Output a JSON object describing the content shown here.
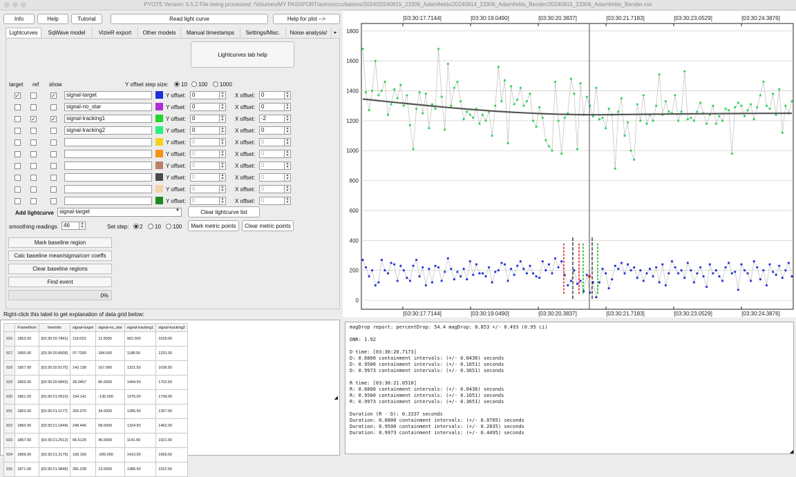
{
  "window": {
    "title": "PYOTE Version: 5.5.2  File being processed: /Volumes/MY PASSPORT/astro/occultations/2024/20240915_23306_Adamfields/20240914_23306_Adamfields_Bender/20240915_23306_Adamfields_Bender.csv"
  },
  "toolbar": {
    "info": "Info",
    "help": "Help",
    "tutorial": "Tutorial",
    "read": "Read light curve",
    "help_plot": "Help for plot -->"
  },
  "tabs": [
    "Lightcurves",
    "SqWave model",
    "VizieR export",
    "Other models",
    "Manual timestamps",
    "Settings/Misc.",
    "Noise analysis/"
  ],
  "tab_scroll": "▸",
  "lc": {
    "help_button": "Lightcurves tab help",
    "col_target": "target",
    "col_ref": "ref",
    "col_show": "show",
    "yoffset_step_label": "Y offset step size:",
    "step_options": [
      "10",
      "100",
      "1000"
    ],
    "yoffset_label": "Y offset:",
    "xoffset_label": "X offset:",
    "rows": [
      {
        "target": "✓",
        "ref": "",
        "show": "✓",
        "name": "signal-target",
        "color": "#1a2fd6",
        "y": "0",
        "x": "0",
        "enabled": true
      },
      {
        "target": "",
        "ref": "",
        "show": "",
        "name": "signal-no_star",
        "color": "#b52bd9",
        "y": "0",
        "x": "0",
        "enabled": true
      },
      {
        "target": "",
        "ref": "✓",
        "show": "✓",
        "name": "signal-tracking1",
        "color": "#22d42b",
        "y": "0",
        "x": "-2",
        "enabled": true
      },
      {
        "target": "",
        "ref": "",
        "show": "",
        "name": "signal-tracking2",
        "color": "#2bf07f",
        "y": "0",
        "x": "0",
        "enabled": true
      },
      {
        "target": "",
        "ref": "",
        "show": "",
        "name": "",
        "color": "#f2d21b",
        "y": "0",
        "x": "0",
        "enabled": false
      },
      {
        "target": "",
        "ref": "",
        "show": "",
        "name": "",
        "color": "#f29312",
        "y": "0",
        "x": "0",
        "enabled": false
      },
      {
        "target": "",
        "ref": "",
        "show": "",
        "name": "",
        "color": "#b98264",
        "y": "0",
        "x": "0",
        "enabled": false
      },
      {
        "target": "",
        "ref": "",
        "show": "",
        "name": "",
        "color": "#4a4a4a",
        "y": "0",
        "x": "0",
        "enabled": false
      },
      {
        "target": "",
        "ref": "",
        "show": "",
        "name": "",
        "color": "#f6d2a8",
        "y": "0",
        "x": "0",
        "enabled": false
      },
      {
        "target": "",
        "ref": "",
        "show": "",
        "name": "",
        "color": "#1e8a1e",
        "y": "0",
        "x": "0",
        "enabled": false
      }
    ],
    "add_label": "Add lightcurve",
    "add_value": "signal-target",
    "clear_list": "Clear lightcurve list",
    "smoothing_label": "smoothing readings",
    "smoothing_value": "46",
    "setstep_label": "Set step:",
    "setstep_options": [
      "2",
      "10",
      "100"
    ],
    "mark_metric": "Mark metric points",
    "clear_metric": "Clear metric points",
    "mark_baseline": "Mark baseline region",
    "calc_baseline": "Calc baseline mean/sigma/corr coeffs",
    "clear_baseline": "Clear baseline regions",
    "find_event": "Find event",
    "progress": "0%"
  },
  "grid_label": "Right-click this label to get explanation of data grid below:",
  "table": {
    "headers": [
      "",
      "FrameNum",
      "timeInfo",
      "signal-target",
      "signal-no_star",
      "signal-tracking1",
      "signal-tracking2"
    ],
    "rows": [
      [
        "926",
        "1853.00",
        "[03:30:20.7841]",
        "119.023",
        "11.0000",
        "962.000",
        "1629.00"
      ],
      [
        "927",
        "1855.00",
        "[03:30:20.8508]",
        "97.7300",
        "184.500",
        "1188.50",
        "1231.00"
      ],
      [
        "928",
        "1857.00",
        "[03:30:20.9175]",
        "142.138",
        "167.000",
        "1321.50",
        "1636.50"
      ],
      [
        "929",
        "1859.00",
        "[03:30:20.9843]",
        "28.0457",
        "80.0000",
        "1494.50",
        "1702.50"
      ],
      [
        "930",
        "1861.00",
        "[03:30:21.0510]",
        "154.141",
        "-136.000",
        "1375.00",
        "1739.00"
      ],
      [
        "931",
        "1863.00",
        "[03:30:21.1177]",
        "253.379",
        "34.0000",
        "1285.50",
        "1357.00"
      ],
      [
        "932",
        "1865.00",
        "[03:30:21.1844]",
        "248.446",
        "58.0000",
        "1324.50",
        "1462.00"
      ],
      [
        "933",
        "1867.00",
        "[03:30:21.2512]",
        "66.5126",
        "46.0000",
        "1141.50",
        "1621.00"
      ],
      [
        "934",
        "1869.00",
        "[03:30:21.3179]",
        "199.169",
        "-209.000",
        "1410.00",
        "1669.50"
      ],
      [
        "935",
        "1871.00",
        "[03:30:21.3846]",
        "281.328",
        "13.0000",
        "1385.50",
        "1522.50"
      ]
    ]
  },
  "report": "magDrop report: percentDrop: 54.4 magDrop: 0.853 +/- 0.493 (0.95 ci)\n\nDNR: 1.92\n\nD time: [03:30:20.7173]\nD: 0.6800 containment intervals: (+/- 0.0436) seconds\nD: 0.9500 containment intervals: (+/- 0.1651) seconds\nD: 0.9973 containment intervals: (+/- 0.3651) seconds\n\nR time: [03:30:21.0510]\nR: 0.6800 containment intervals: (+/- 0.0436) seconds\nR: 0.9500 containment intervals: (+/- 0.1651) seconds\nR: 0.9973 containment intervals: (+/- 0.3651) seconds\n\nDuration (R - D): 0.3337 seconds\nDuration: 0.6800 containment intervals: (+/- 0.0705) seconds\nDuration: 0.9500 containment intervals: (+/- 0.2035) seconds\nDuration: 0.9973 containment intervals: (+/- 0.4495) seconds",
  "chart_data": {
    "type": "scatter",
    "x_tick_labels": [
      "[03:30:17.7144]",
      "[03:30:19.0490]",
      "[03:30:20.3837]",
      "[03:30:21.7183]",
      "[03:30:23.0529]",
      "[03:30:24.3876]"
    ],
    "y_ticks": [
      0,
      200,
      400,
      600,
      800,
      1000,
      1200,
      1400,
      1600,
      1800
    ],
    "ylim": [
      -60,
      1850
    ],
    "grid": true,
    "colors": {
      "tracking": "#2ed65a",
      "target": "#2236d8",
      "smooth": "#555555",
      "d_edge": "#e01b1b",
      "r_edge": "#19b419"
    },
    "series": [
      {
        "values": [
          1680,
          1390,
          1270,
          1400,
          1600,
          1370,
          1400,
          1460,
          1240,
          1310,
          1410,
          1350,
          1440,
          1300,
          1370,
          1170,
          1010,
          1280,
          1390,
          1250,
          1380,
          1150,
          1310,
          1280,
          1680,
          1360,
          1140,
          1580,
          1300,
          1420,
          1460,
          1330,
          1210,
          1260,
          1240,
          1220,
          1280,
          1180,
          1240,
          1200,
          1260,
          1100,
          1300,
          1560,
          1330,
          1470,
          1050,
          1430,
          1310,
          1340,
          1420,
          1300,
          1330,
          1380,
          1200,
          1160,
          1290,
          1220,
          1070,
          1030,
          1000,
          1460,
          1200,
          980,
          1220,
          1250,
          1480,
          1380,
          1010,
          1450,
          1240,
          1360,
          1300,
          1230,
          1420,
          1210,
          1220,
          1150,
          1280,
          1240,
          880,
          1260,
          1350,
          1100,
          1190,
          1000,
          940,
          1310,
          1200,
          1370,
          1180,
          1240,
          1200,
          1300,
          1510,
          1240,
          1330,
          1260,
          1250,
          1370,
          1200,
          1260,
          1530,
          1210,
          1220,
          1200,
          1260,
          1320,
          1250,
          1180,
          1240,
          1300,
          1180,
          1230,
          1200,
          1280,
          1270,
          980,
          1290,
          1320,
          1300,
          1230,
          1270,
          1310,
          1210,
          1290,
          1370,
          1460,
          1300,
          1280,
          1380,
          1240,
          1410,
          1120,
          1300,
          1250,
          1330
        ]
      },
      {
        "values": [
          270,
          220,
          160,
          200,
          100,
          120,
          270,
          200,
          180,
          250,
          240,
          130,
          230,
          200,
          150,
          130,
          230,
          270,
          160,
          220,
          100,
          210,
          120,
          230,
          220,
          130,
          190,
          280,
          210,
          140,
          190,
          160,
          210,
          140,
          260,
          170,
          240,
          180,
          180,
          160,
          220,
          120,
          190,
          200,
          250,
          240,
          130,
          210,
          170,
          230,
          260,
          210,
          180,
          230,
          180,
          160,
          150,
          260,
          200,
          240,
          180,
          280,
          220,
          260,
          170,
          100,
          130,
          200,
          110,
          130,
          60,
          170,
          50,
          120,
          20,
          120,
          210,
          180,
          80,
          140,
          230,
          210,
          250,
          180,
          240,
          200,
          220,
          150,
          200,
          130,
          180,
          210,
          160,
          220,
          120,
          240,
          100,
          180,
          260,
          220,
          180,
          200,
          150,
          250,
          200,
          120,
          180,
          220,
          160,
          90,
          240,
          180,
          200,
          160,
          130,
          220,
          250,
          180,
          190,
          70,
          240,
          200,
          180,
          130,
          260,
          220,
          140,
          200,
          100,
          240,
          190,
          170,
          230,
          150,
          200,
          250,
          160
        ]
      }
    ]
  }
}
